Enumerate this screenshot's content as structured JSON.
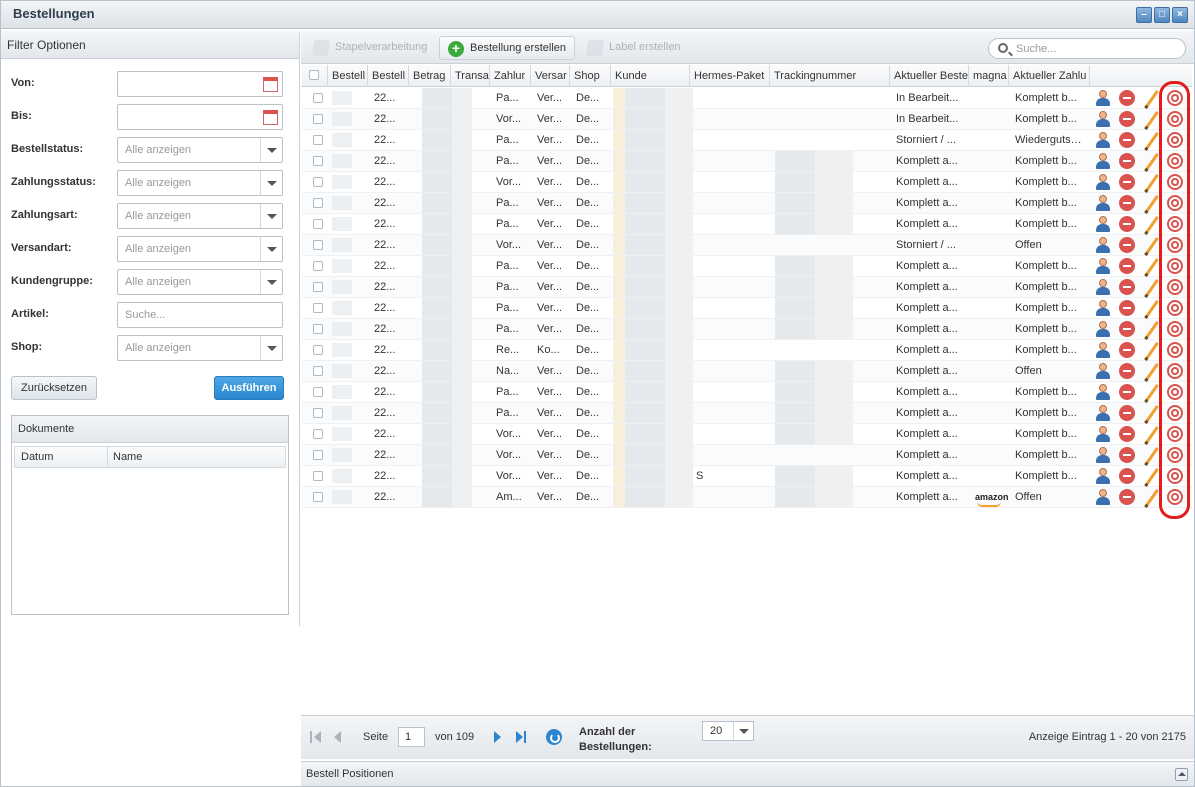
{
  "window": {
    "title": "Bestellungen"
  },
  "filter": {
    "header": "Filter Optionen",
    "fields": [
      {
        "label": "Von:",
        "type": "date",
        "placeholder": ""
      },
      {
        "label": "Bis:",
        "type": "date",
        "placeholder": ""
      },
      {
        "label": "Bestellstatus:",
        "type": "select",
        "placeholder": "Alle anzeigen"
      },
      {
        "label": "Zahlungsstatus:",
        "type": "select",
        "placeholder": "Alle anzeigen"
      },
      {
        "label": "Zahlungsart:",
        "type": "select",
        "placeholder": "Alle anzeigen"
      },
      {
        "label": "Versandart:",
        "type": "select",
        "placeholder": "Alle anzeigen"
      },
      {
        "label": "Kundengruppe:",
        "type": "select",
        "placeholder": "Alle anzeigen"
      },
      {
        "label": "Artikel:",
        "type": "text",
        "placeholder": "Suche..."
      },
      {
        "label": "Shop:",
        "type": "select",
        "placeholder": "Alle anzeigen"
      }
    ],
    "reset_label": "Zurücksetzen",
    "run_label": "Ausführen"
  },
  "documents": {
    "header": "Dokumente",
    "columns": [
      "Datum",
      "Name"
    ]
  },
  "toolbar": {
    "batch_label": "Stapelverarbeitung",
    "create_label": "Bestellung erstellen",
    "label_label": "Label erstellen",
    "search_placeholder": "Suche..."
  },
  "grid": {
    "columns": [
      "Bestell",
      "Bestell",
      "Betrag",
      "Transa",
      "Zahlur",
      "Versar",
      "Shop",
      "Kunde",
      "Hermes-Paket",
      "Trackingnummer",
      "Aktueller Beste",
      "magna",
      "Aktueller Zahlu"
    ],
    "rows": [
      {
        "c2": "22...",
        "c5": "Pa...",
        "c6": "Ver...",
        "c7": "De...",
        "hermes": "",
        "status": "In Bearbeit...",
        "pay": "Komplett b...",
        "amazon": ""
      },
      {
        "c2": "22...",
        "c5": "Vor...",
        "c6": "Ver...",
        "c7": "De...",
        "hermes": "",
        "status": "In Bearbeit...",
        "pay": "Komplett b...",
        "amazon": ""
      },
      {
        "c2": "22...",
        "c5": "Pa...",
        "c6": "Ver...",
        "c7": "De...",
        "hermes": "",
        "status": "Storniert / ...",
        "pay": "Wiedergutss...",
        "amazon": ""
      },
      {
        "c2": "22...",
        "c5": "Pa...",
        "c6": "Ver...",
        "c7": "De...",
        "hermes": "",
        "status": "Komplett a...",
        "pay": "Komplett b...",
        "amazon": ""
      },
      {
        "c2": "22...",
        "c5": "Vor...",
        "c6": "Ver...",
        "c7": "De...",
        "hermes": "",
        "status": "Komplett a...",
        "pay": "Komplett b...",
        "amazon": ""
      },
      {
        "c2": "22...",
        "c5": "Pa...",
        "c6": "Ver...",
        "c7": "De...",
        "hermes": "",
        "status": "Komplett a...",
        "pay": "Komplett b...",
        "amazon": ""
      },
      {
        "c2": "22...",
        "c5": "Pa...",
        "c6": "Ver...",
        "c7": "De...",
        "hermes": "",
        "status": "Komplett a...",
        "pay": "Komplett b...",
        "amazon": ""
      },
      {
        "c2": "22...",
        "c5": "Vor...",
        "c6": "Ver...",
        "c7": "De...",
        "hermes": "",
        "status": "Storniert / ...",
        "pay": "Offen",
        "amazon": ""
      },
      {
        "c2": "22...",
        "c5": "Pa...",
        "c6": "Ver...",
        "c7": "De...",
        "hermes": "",
        "status": "Komplett a...",
        "pay": "Komplett b...",
        "amazon": ""
      },
      {
        "c2": "22...",
        "c5": "Pa...",
        "c6": "Ver...",
        "c7": "De...",
        "hermes": "",
        "status": "Komplett a...",
        "pay": "Komplett b...",
        "amazon": ""
      },
      {
        "c2": "22...",
        "c5": "Pa...",
        "c6": "Ver...",
        "c7": "De...",
        "hermes": "",
        "status": "Komplett a...",
        "pay": "Komplett b...",
        "amazon": ""
      },
      {
        "c2": "22...",
        "c5": "Pa...",
        "c6": "Ver...",
        "c7": "De...",
        "hermes": "",
        "status": "Komplett a...",
        "pay": "Komplett b...",
        "amazon": ""
      },
      {
        "c2": "22...",
        "c5": "Re...",
        "c6": "Ko...",
        "c7": "De...",
        "hermes": "",
        "status": "Komplett a...",
        "pay": "Komplett b...",
        "amazon": ""
      },
      {
        "c2": "22...",
        "c5": "Na...",
        "c6": "Ver...",
        "c7": "De...",
        "hermes": "",
        "status": "Komplett a...",
        "pay": "Offen",
        "amazon": ""
      },
      {
        "c2": "22...",
        "c5": "Pa...",
        "c6": "Ver...",
        "c7": "De...",
        "hermes": "",
        "status": "Komplett a...",
        "pay": "Komplett b...",
        "amazon": ""
      },
      {
        "c2": "22...",
        "c5": "Pa...",
        "c6": "Ver...",
        "c7": "De...",
        "hermes": "",
        "status": "Komplett a...",
        "pay": "Komplett b...",
        "amazon": ""
      },
      {
        "c2": "22...",
        "c5": "Vor...",
        "c6": "Ver...",
        "c7": "De...",
        "hermes": "",
        "status": "Komplett a...",
        "pay": "Komplett b...",
        "amazon": ""
      },
      {
        "c2": "22...",
        "c5": "Vor...",
        "c6": "Ver...",
        "c7": "De...",
        "hermes": "",
        "status": "Komplett a...",
        "pay": "Komplett b...",
        "amazon": ""
      },
      {
        "c2": "22...",
        "c5": "Vor...",
        "c6": "Ver...",
        "c7": "De...",
        "hermes": "S",
        "status": "Komplett a...",
        "pay": "Komplett b...",
        "amazon": ""
      },
      {
        "c2": "22...",
        "c5": "Am...",
        "c6": "Ver...",
        "c7": "De...",
        "hermes": "",
        "status": "Komplett a...",
        "pay": "Offen",
        "amazon": "amazon"
      }
    ]
  },
  "pager": {
    "page_label": "Seite",
    "page_value": "1",
    "of_label": "von 109",
    "per_page_label_1": "Anzahl der",
    "per_page_label_2": "Bestellungen:",
    "per_page_value": "20",
    "summary": "Anzeige Eintrag 1 - 20 von 2175"
  },
  "positions": {
    "label": "Bestell Positionen"
  }
}
